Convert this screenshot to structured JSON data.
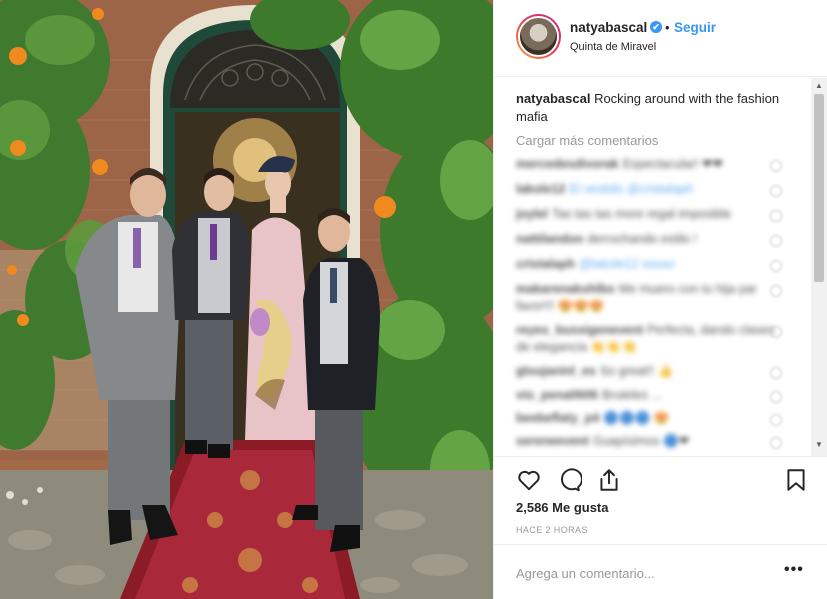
{
  "post": {
    "username": "natyabascal",
    "verified_badge": "✔",
    "separator": "•",
    "follow_label": "Seguir",
    "location": "Quinta de Miravel",
    "caption": {
      "username": "natyabascal",
      "text": "Rocking around with the fashion mafia"
    },
    "load_more_label": "Cargar más comentarios",
    "comments": [
      {
        "user": "mercedesdivorak",
        "text": "Espectacular! ❤❤"
      },
      {
        "user": "lakole12",
        "text": "El vestido @cristalaph"
      },
      {
        "user": "joylel",
        "text": "Tas tas tas more regal imposible"
      },
      {
        "user": "nattilandon",
        "text": "derrochando estilo !"
      },
      {
        "user": "cristalaph",
        "text": "@lakole12 xoxxo"
      },
      {
        "user": "makarenakohlbs",
        "text": "Me muero con tu hija par favor!!! 😍😍😍"
      },
      {
        "user": "reyes_bussigenevent",
        "text": "Perfecta, dando clases de elegancia 👏👏👏"
      },
      {
        "user": "gloujaninl_es",
        "text": "So great!! 👍"
      },
      {
        "user": "vio_pena0606",
        "text": "Bruteles ..."
      },
      {
        "user": "beebeflaty_p4",
        "text": "🔵🔵🔵 😍"
      },
      {
        "user": "sereneevent",
        "text": "Guapísimos 🔵❤"
      }
    ],
    "likes": "2,586 Me gusta",
    "timestamp": "HACE 2 HORAS",
    "add_comment_placeholder": "Agrega un comentario...",
    "more_options": "•••",
    "icons": {
      "like": "heart-icon",
      "comment": "comment-icon",
      "share": "share-icon",
      "save": "bookmark-icon"
    },
    "colors": {
      "link": "#3897f0",
      "text": "#262626",
      "muted": "#999999",
      "border": "#efefef"
    }
  }
}
